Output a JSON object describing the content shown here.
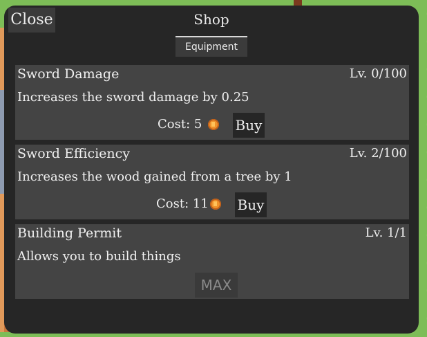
{
  "panel": {
    "close_label": "Close",
    "title": "Shop",
    "tab_label": "Equipment"
  },
  "upgrades": [
    {
      "name": "Sword Damage",
      "level": "Lv. 0/100",
      "description": "Increases the sword damage by 0.25",
      "cost_label": "Cost: 5",
      "button_label": "Buy"
    },
    {
      "name": "Sword Efficiency",
      "level": "Lv. 2/100",
      "description": "Increases the wood gained from a tree by 1",
      "cost_label": "Cost: 11",
      "button_label": "Buy"
    },
    {
      "name": "Building Permit",
      "level": "Lv. 1/1",
      "description": "Allows you to build things",
      "button_label": "MAX"
    }
  ],
  "icons": {
    "currency": "wood-coin-icon"
  },
  "colors": {
    "panel_bg": "#262626",
    "card_bg": "#444444",
    "coin": "#f0922a"
  }
}
